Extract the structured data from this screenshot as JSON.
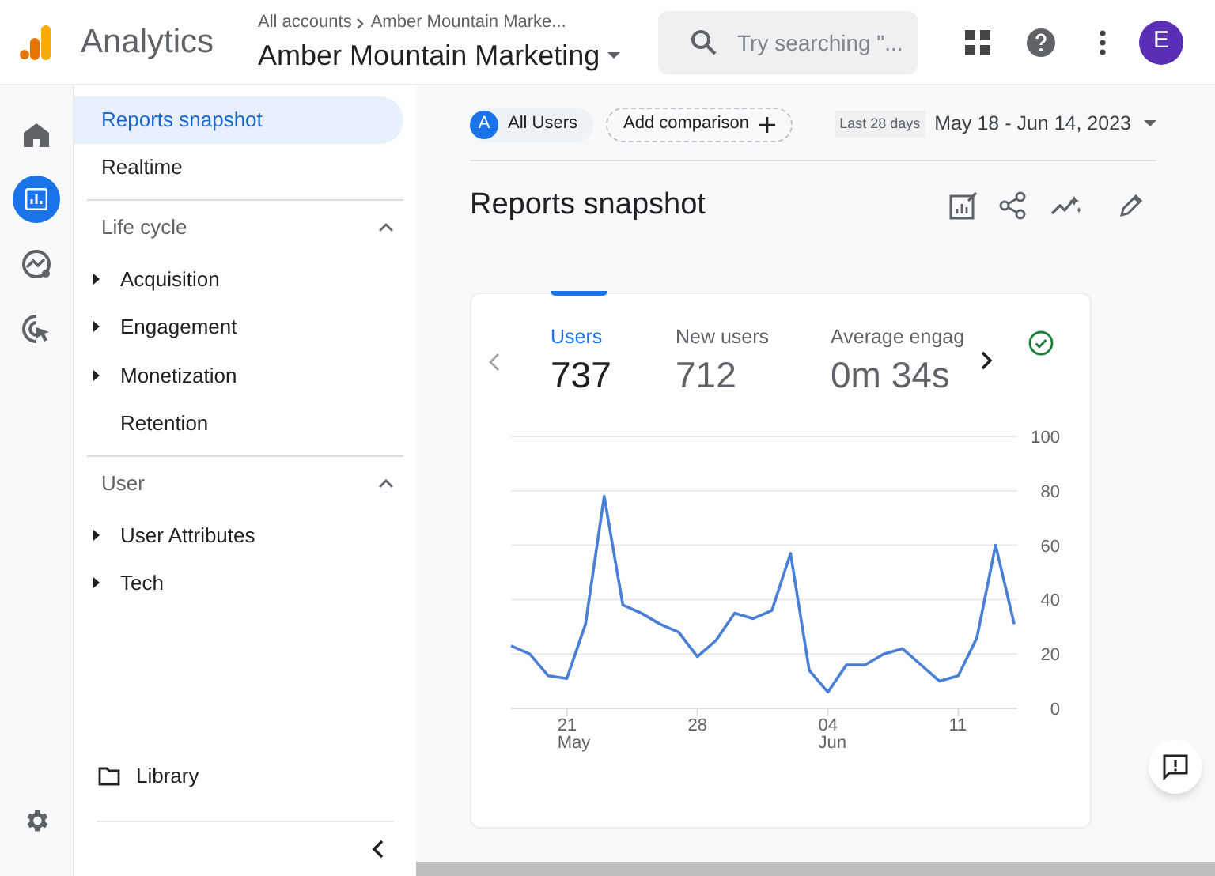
{
  "header": {
    "product": "Analytics",
    "breadcrumb_root": "All accounts",
    "breadcrumb_current": "Amber Mountain Marke...",
    "property": "Amber Mountain Marketing",
    "search_placeholder": "Try searching \"...",
    "avatar": "E"
  },
  "rail": [
    {
      "kind": "home",
      "selected": false
    },
    {
      "kind": "reports",
      "selected": true
    },
    {
      "kind": "explore",
      "selected": false
    },
    {
      "kind": "advertising",
      "selected": false
    }
  ],
  "nav": {
    "items": [
      {
        "label": "Reports snapshot",
        "selected": true
      },
      {
        "label": "Realtime",
        "selected": false
      }
    ],
    "sections": [
      {
        "title": "Life cycle",
        "expanded": true,
        "items": [
          {
            "label": "Acquisition",
            "expandable": true
          },
          {
            "label": "Engagement",
            "expandable": true
          },
          {
            "label": "Monetization",
            "expandable": true
          },
          {
            "label": "Retention",
            "expandable": false
          }
        ]
      },
      {
        "title": "User",
        "expanded": true,
        "items": [
          {
            "label": "User Attributes",
            "expandable": true
          },
          {
            "label": "Tech",
            "expandable": true
          }
        ]
      }
    ],
    "library": "Library"
  },
  "toolbar": {
    "segment_badge": "A",
    "segment_label": "All Users",
    "add_comparison": "Add comparison",
    "date_label": "Last 28 days",
    "date_range": "May 18 - Jun 14, 2023"
  },
  "title": "Reports snapshot",
  "card": {
    "metrics": [
      {
        "label": "Users",
        "value": "737",
        "selected": true
      },
      {
        "label": "New users",
        "value": "712",
        "selected": false
      },
      {
        "label": "Average engag",
        "value": "0m 34s",
        "selected": false
      }
    ],
    "chart_data": {
      "type": "line",
      "categories": [
        null,
        null,
        null,
        "21\nMay",
        null,
        null,
        null,
        null,
        null,
        null,
        "28",
        null,
        null,
        null,
        null,
        null,
        null,
        "04\nJun",
        null,
        null,
        null,
        null,
        null,
        null,
        "11",
        null,
        null,
        null
      ],
      "values": [
        23,
        20,
        12,
        11,
        31,
        78,
        38,
        35,
        31,
        28,
        19,
        25,
        35,
        33,
        36,
        57,
        14,
        6,
        16,
        16,
        20,
        22,
        16,
        10,
        12,
        26,
        60,
        31
      ],
      "ylim": [
        0,
        100
      ],
      "yticks": [
        0,
        20,
        40,
        60,
        80,
        100
      ],
      "grid": true
    }
  }
}
